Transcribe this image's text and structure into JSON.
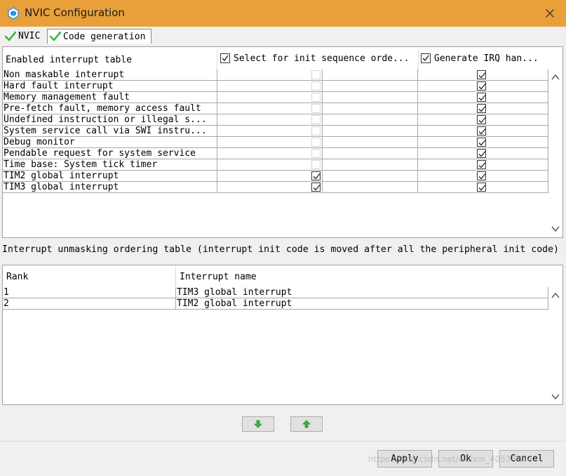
{
  "window": {
    "title": "NVIC Configuration",
    "accent_color": "#e9a03b",
    "icon": "cube-icon",
    "close_icon": "close-icon"
  },
  "tabs": [
    {
      "label": "NVIC",
      "icon": "green-check-icon",
      "selected": false
    },
    {
      "label": "Code generation",
      "icon": "green-check-icon",
      "selected": true
    }
  ],
  "enabled_table": {
    "headers": {
      "name": "Enabled interrupt table",
      "init_sequence": "Select for init sequence orde...",
      "irq_handler": "Generate IRQ han..."
    },
    "rows": [
      {
        "name": "Non maskable interrupt",
        "init_sequence": false,
        "init_enabled": false,
        "irq": true
      },
      {
        "name": "Hard fault interrupt",
        "init_sequence": false,
        "init_enabled": false,
        "irq": true
      },
      {
        "name": "Memory management fault",
        "init_sequence": false,
        "init_enabled": false,
        "irq": true
      },
      {
        "name": "Pre-fetch fault, memory access fault",
        "init_sequence": false,
        "init_enabled": false,
        "irq": true
      },
      {
        "name": "Undefined instruction or illegal s...",
        "init_sequence": false,
        "init_enabled": false,
        "irq": true
      },
      {
        "name": "System service call via SWI instru...",
        "init_sequence": false,
        "init_enabled": false,
        "irq": true
      },
      {
        "name": "Debug monitor",
        "init_sequence": false,
        "init_enabled": false,
        "irq": true
      },
      {
        "name": "Pendable request for system service",
        "init_sequence": false,
        "init_enabled": false,
        "irq": true
      },
      {
        "name": "Time base: System tick timer",
        "init_sequence": false,
        "init_enabled": false,
        "irq": true
      },
      {
        "name": "TIM2 global interrupt",
        "init_sequence": true,
        "init_enabled": true,
        "irq": true
      },
      {
        "name": "TIM3 global interrupt",
        "init_sequence": true,
        "init_enabled": true,
        "irq": true
      }
    ]
  },
  "ordering_caption": "Interrupt unmasking ordering table (interrupt init code is moved after all the peripheral init code)",
  "ordering_table": {
    "headers": {
      "rank": "Rank",
      "name": "Interrupt name"
    },
    "rows": [
      {
        "rank": "1",
        "name": "TIM3 global interrupt"
      },
      {
        "rank": "2",
        "name": "TIM2 global interrupt"
      }
    ]
  },
  "move_buttons": {
    "down_icon": "green-arrow-down-icon",
    "up_icon": "green-arrow-up-icon"
  },
  "footer": {
    "apply": "Apply",
    "ok": "Ok",
    "cancel": "Cancel"
  },
  "watermark": "https://blog.csdn.net/weixin_40538754"
}
